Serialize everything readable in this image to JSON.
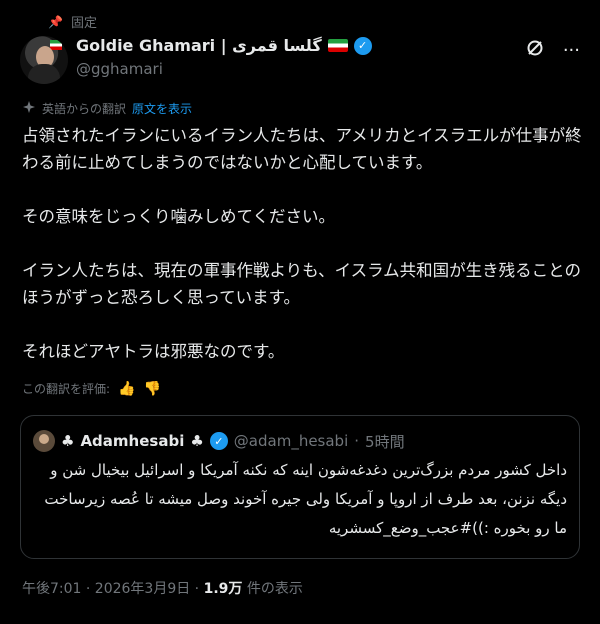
{
  "pinned": {
    "label": "固定"
  },
  "author": {
    "name": "Goldie Ghamari | گلسا قمری",
    "handle": "@gghamari"
  },
  "translation": {
    "label": "英語からの翻訳",
    "show_original": "原文を表示"
  },
  "tweet": {
    "paragraphs": [
      "占領されたイランにいるイラン人たちは、アメリカとイスラエルが仕事が終わる前に止めてしまうのではないかと心配しています。",
      "その意味をじっくり噛みしめてください。",
      "イラン人たちは、現在の軍事作戦よりも、イスラム共和国が生き残ることのほうがずっと恐ろしく思っています。",
      "それほどアヤトラは邪悪なのです。"
    ]
  },
  "rating": {
    "label": "この翻訳を評価:"
  },
  "quote": {
    "name": "Adamhesabi",
    "handle": "@adam_hesabi",
    "time": "5時間",
    "lines": [
      "داخل کشور مردم بزرگ‌ترین دغدغه‌شون اینه که نکنه آمریکا و اسرائیل بیخیال شن و",
      "دیگه نزنن، بعد طرف از اروپا و آمریکا ولی جیره آخوند وصل میشه تا عُصه زیرساخت",
      "ما رو بخوره :))#عجب_وضع_کسشریه"
    ]
  },
  "meta": {
    "timestamp": "午後7:01 · 2026年3月9日 · ",
    "views_count": "1.9万",
    "views_label": " 件の表示"
  },
  "colors": {
    "accent": "#1d9bf0",
    "background": "#000000",
    "muted": "#71767b",
    "text": "#e7e9ea"
  }
}
